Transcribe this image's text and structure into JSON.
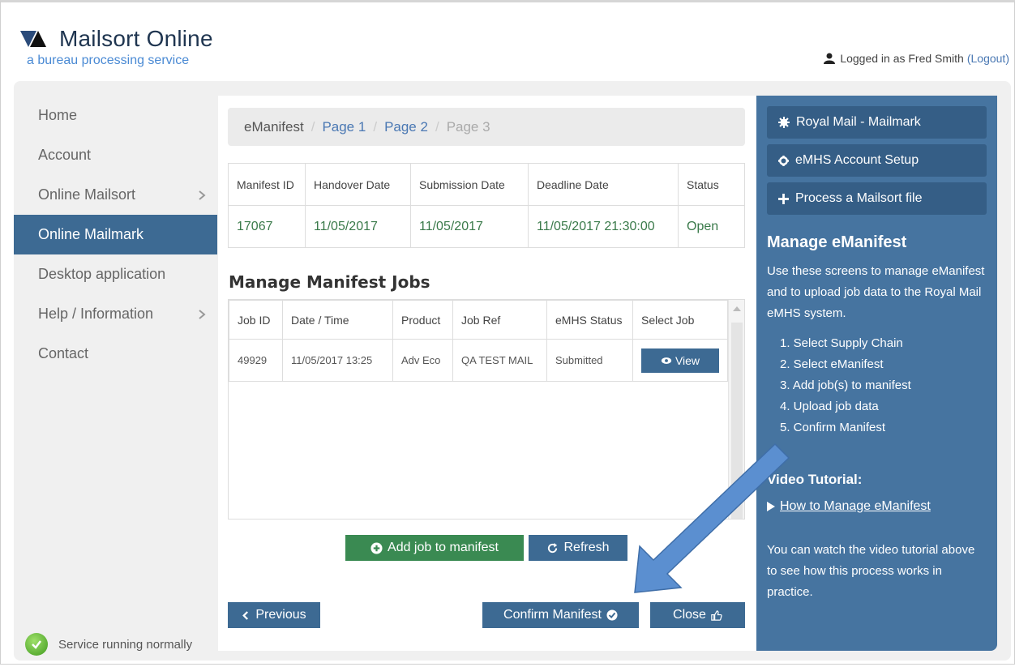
{
  "header": {
    "app_title": "Mailsort Online",
    "app_subtitle": "a bureau processing service",
    "logged_in_text": "Logged in as Fred Smith",
    "logout_link": "(Logout)"
  },
  "sidebar": {
    "items": [
      {
        "label": "Home"
      },
      {
        "label": "Account"
      },
      {
        "label": "Online Mailsort"
      },
      {
        "label": "Online Mailmark"
      },
      {
        "label": "Desktop application"
      },
      {
        "label": "Help / Information"
      },
      {
        "label": "Contact"
      }
    ],
    "status_text": "Service running normally"
  },
  "breadcrumb": [
    "eManifest",
    "Page 1",
    "Page 2",
    "Page 3"
  ],
  "manifest_table": {
    "headers": [
      "Manifest ID",
      "Handover Date",
      "Submission Date",
      "Deadline Date",
      "Status"
    ],
    "row": [
      "17067",
      "11/05/2017",
      "11/05/2017",
      "11/05/2017 21:30:00",
      "Open"
    ]
  },
  "jobs": {
    "heading": "Manage Manifest Jobs",
    "headers": [
      "Job ID",
      "Date / Time",
      "Product",
      "Job Ref",
      "eMHS Status",
      "Select Job"
    ],
    "row": [
      "49929",
      "11/05/2017 13:25",
      "Adv Eco",
      "QA TEST MAIL",
      "Submitted"
    ],
    "view_label": "View"
  },
  "actions": {
    "add_job": "Add job to manifest",
    "refresh": "Refresh",
    "previous": "Previous",
    "confirm": "Confirm Manifest",
    "close": "Close"
  },
  "right_panel": {
    "buttons": [
      "Royal Mail - Mailmark",
      "eMHS Account Setup",
      "Process a Mailsort file"
    ],
    "heading": "Manage eManifest",
    "description": "Use these screens to manage eManifest and to upload job data to the Royal Mail eMHS system.",
    "steps": [
      "1. Select Supply Chain",
      "2. Select eManifest",
      "3. Add job(s) to manifest",
      "4. Upload job data",
      "5. Confirm Manifest"
    ],
    "video_heading": "Video Tutorial:",
    "video_link": "How to Manage eManifest",
    "video_note": "You can watch the video tutorial above to see how this process works in practice."
  },
  "colors": {
    "nav_active": "#3d6a93",
    "panel_bg": "#4674a0",
    "success_green": "#3a8a52",
    "open_status": "#3a7a4a"
  }
}
